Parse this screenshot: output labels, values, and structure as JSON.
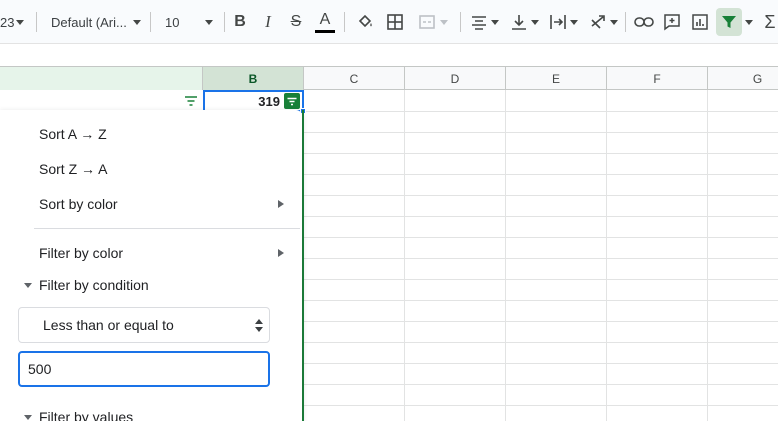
{
  "toolbar": {
    "font_size_partial": "23",
    "font_family": "Default (Ari...",
    "font_size": "10",
    "bold": "B",
    "italic": "I",
    "strike": "S",
    "text_color_letter": "A"
  },
  "columns": [
    {
      "id": "a",
      "label": ""
    },
    {
      "id": "b",
      "label": "B"
    },
    {
      "id": "c",
      "label": "C"
    },
    {
      "id": "d",
      "label": "D"
    },
    {
      "id": "e",
      "label": "E"
    },
    {
      "id": "f",
      "label": "F"
    },
    {
      "id": "g",
      "label": "G"
    }
  ],
  "cells": {
    "b1": "319"
  },
  "filter_menu": {
    "sort_az": "Sort A → Z",
    "sort_za": "Sort Z → A",
    "sort_by_color": "Sort by color",
    "filter_by_color": "Filter by color",
    "filter_by_condition": "Filter by condition",
    "condition_selected": "Less than or equal to",
    "condition_value": "500",
    "filter_by_values": "Filter by values"
  },
  "colors": {
    "accent_blue": "#1a73e8",
    "filter_green": "#188038",
    "selected_header": "#d3e3d5"
  }
}
